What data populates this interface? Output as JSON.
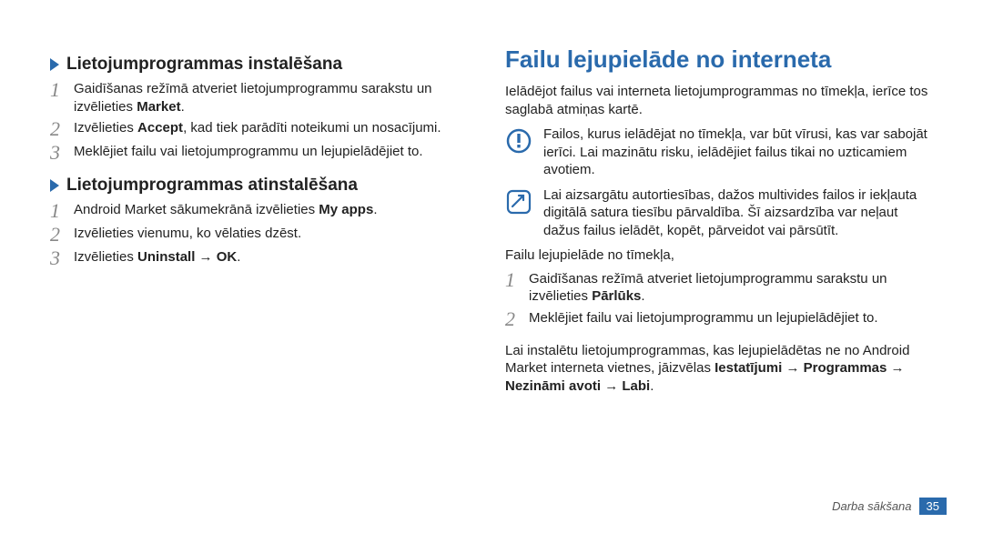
{
  "left": {
    "sections": [
      {
        "heading": "Lietojumprogrammas instalēšana",
        "steps": [
          {
            "pre": "Gaidīšanas režīmā atveriet lietojumprogrammu sarakstu un izvēlieties ",
            "b1": "Market",
            "post": "."
          },
          {
            "pre": "Izvēlieties ",
            "b1": "Accept",
            "post": ", kad tiek parādīti noteikumi un nosacījumi."
          },
          {
            "pre": "Meklējiet failu vai lietojumprogrammu un lejupielādējiet to.",
            "b1": "",
            "post": ""
          }
        ]
      },
      {
        "heading": "Lietojumprogrammas atinstalēšana",
        "steps": [
          {
            "pre": "Android Market sākumekrānā izvēlieties ",
            "b1": "My apps",
            "post": "."
          },
          {
            "pre": "Izvēlieties vienumu, ko vēlaties dzēst.",
            "b1": "",
            "post": ""
          },
          {
            "pre": "Izvēlieties ",
            "b1": "Uninstall",
            "post": " → ",
            "b2": "OK",
            "post2": "."
          }
        ]
      }
    ]
  },
  "right": {
    "title": "Failu lejupielāde no interneta",
    "intro": "Ielādējot failus vai interneta lietojumprogrammas no tīmekļa, ierīce tos saglabā atmiņas kartē.",
    "warning": "Failos, kurus ielādējat no tīmekļa, var būt vīrusi, kas var sabojāt ierīci. Lai mazinātu risku, ielādējiet failus tikai no uzticamiem avotiem.",
    "note": "Lai aizsargātu autortiesības, dažos multivides failos ir iekļauta digitālā satura tiesību pārvaldība. Šī aizsardzība var neļaut dažus failus ielādēt, kopēt, pārveidot vai pārsūtīt.",
    "download_label": "Failu lejupielāde no tīmekļa,",
    "steps": [
      {
        "pre": "Gaidīšanas režīmā atveriet lietojumprogrammu sarakstu un izvēlieties ",
        "b1": "Pārlūks",
        "post": "."
      },
      {
        "pre": "Meklējiet failu vai lietojumprogrammu un lejupielādējiet to.",
        "b1": "",
        "post": ""
      }
    ],
    "outro_pre": "Lai instalētu lietojumprogrammas, kas lejupielādētas ne no Android Market interneta vietnes, jāizvēlas ",
    "outro_b1": "Iestatījumi",
    "outro_mid": " → ",
    "outro_b2": "Programmas",
    "outro_mid2": " → ",
    "outro_b3": "Nezināmi avoti",
    "outro_mid3": " → ",
    "outro_b4": "Labi",
    "outro_post": "."
  },
  "footer": {
    "label": "Darba sākšana",
    "page": "35"
  }
}
